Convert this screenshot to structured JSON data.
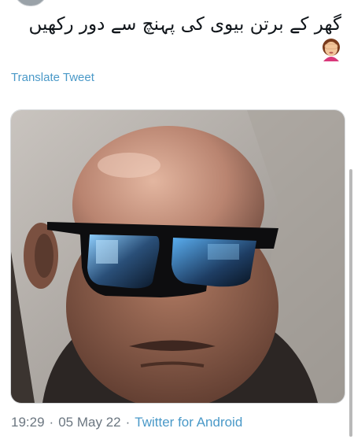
{
  "tweet": {
    "text": "گھر کے برتن بیوی کی پہنچ سے دور رکھیں",
    "emoji_icon": "woman-facepalming-icon"
  },
  "translate_label": "Translate Tweet",
  "meta": {
    "time": "19:29",
    "separator": "·",
    "date": "05 May 22",
    "source": "Twitter for Android"
  },
  "colors": {
    "link": "#4a99c8",
    "meta_text": "#6b7680",
    "body_text": "#0f1419"
  }
}
